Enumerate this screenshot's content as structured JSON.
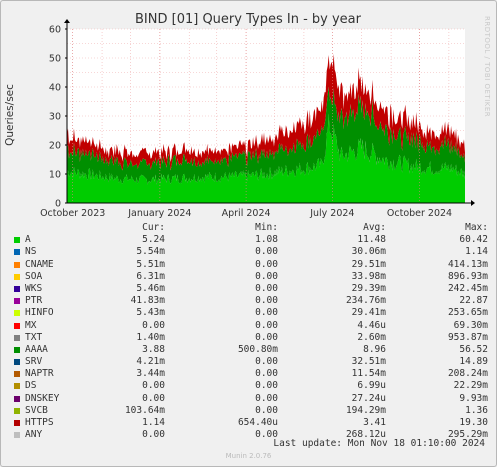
{
  "chart_data": {
    "type": "area",
    "title": "BIND [01] Query Types In - by year",
    "ylabel": "Queries/sec",
    "side_label": "RRDTOOL / TOBI OETIKER",
    "ylim": [
      0,
      60
    ],
    "yticks": [
      0,
      10,
      20,
      30,
      40,
      50,
      60
    ],
    "xlim": [
      "2023-09-25",
      "2024-11-18"
    ],
    "xticks": [
      {
        "date": "2023-10-01",
        "label": "October 2023"
      },
      {
        "date": "2024-01-01",
        "label": "January 2024"
      },
      {
        "date": "2024-04-01",
        "label": "April 2024"
      },
      {
        "date": "2024-07-01",
        "label": "July 2024"
      },
      {
        "date": "2024-10-01",
        "label": "October 2024"
      }
    ],
    "grid": true,
    "colors": {
      "A": "#00cc00",
      "AAAA": "#008f00",
      "HTTPS": "#c00000",
      "background": "#ffffff"
    },
    "series": [
      {
        "name": "A",
        "x": [
          "2023-09-25",
          "2023-10-15",
          "2023-11-15",
          "2023-12-15",
          "2024-01-15",
          "2024-02-15",
          "2024-03-15",
          "2024-04-10",
          "2024-05-10",
          "2024-06-01",
          "2024-06-20",
          "2024-06-28",
          "2024-07-10",
          "2024-08-01",
          "2024-08-25",
          "2024-09-20",
          "2024-10-15",
          "2024-11-05",
          "2024-11-18"
        ],
        "values": [
          11,
          10,
          8.5,
          8,
          8.5,
          9,
          9,
          9.5,
          11,
          12,
          13,
          27,
          16,
          19,
          15,
          13,
          12,
          12,
          10
        ]
      },
      {
        "name": "AAAA",
        "x": [
          "2023-09-25",
          "2023-10-15",
          "2023-11-15",
          "2023-12-15",
          "2024-01-15",
          "2024-02-15",
          "2024-03-15",
          "2024-04-10",
          "2024-05-10",
          "2024-06-01",
          "2024-06-20",
          "2024-06-28",
          "2024-07-10",
          "2024-08-01",
          "2024-08-25",
          "2024-09-20",
          "2024-10-15",
          "2024-11-05",
          "2024-11-18"
        ],
        "values": [
          8,
          7,
          6,
          5.5,
          6,
          6,
          6,
          6.5,
          8,
          9,
          10,
          12,
          12,
          14,
          11,
          9,
          8,
          8,
          5
        ]
      },
      {
        "name": "HTTPS",
        "x": [
          "2023-09-25",
          "2023-10-15",
          "2023-11-15",
          "2023-12-15",
          "2024-01-15",
          "2024-02-15",
          "2024-03-15",
          "2024-04-10",
          "2024-05-10",
          "2024-06-01",
          "2024-06-20",
          "2024-06-28",
          "2024-07-10",
          "2024-08-01",
          "2024-08-25",
          "2024-09-20",
          "2024-10-15",
          "2024-11-05",
          "2024-11-18"
        ],
        "values": [
          5,
          4,
          3.5,
          3.5,
          3.5,
          3.5,
          3.5,
          4,
          6,
          7,
          8,
          13,
          8,
          8,
          7,
          6,
          5,
          5,
          4
        ]
      }
    ]
  },
  "legend": {
    "headers": [
      "Cur:",
      "Min:",
      "Avg:",
      "Max:"
    ],
    "rows": [
      {
        "name": "A",
        "color": "#00cc00",
        "cur": "5.24",
        "min": "1.08",
        "avg": "11.48",
        "max": "60.42"
      },
      {
        "name": "NS",
        "color": "#0066b3",
        "cur": "5.54m",
        "min": "0.00",
        "avg": "30.06m",
        "max": "1.14"
      },
      {
        "name": "CNAME",
        "color": "#ff8000",
        "cur": "5.51m",
        "min": "0.00",
        "avg": "29.51m",
        "max": "414.13m"
      },
      {
        "name": "SOA",
        "color": "#ffcc00",
        "cur": "6.31m",
        "min": "0.00",
        "avg": "33.98m",
        "max": "896.93m"
      },
      {
        "name": "WKS",
        "color": "#330099",
        "cur": "5.46m",
        "min": "0.00",
        "avg": "29.39m",
        "max": "242.45m"
      },
      {
        "name": "PTR",
        "color": "#990099",
        "cur": "41.83m",
        "min": "0.00",
        "avg": "234.76m",
        "max": "22.87"
      },
      {
        "name": "HINFO",
        "color": "#ccff00",
        "cur": "5.43m",
        "min": "0.00",
        "avg": "29.41m",
        "max": "253.65m"
      },
      {
        "name": "MX",
        "color": "#ff0000",
        "cur": "0.00",
        "min": "0.00",
        "avg": "4.46u",
        "max": "69.30m"
      },
      {
        "name": "TXT",
        "color": "#808080",
        "cur": "1.40m",
        "min": "0.00",
        "avg": "2.60m",
        "max": "953.87m"
      },
      {
        "name": "AAAA",
        "color": "#008f00",
        "cur": "3.88",
        "min": "500.80m",
        "avg": "8.96",
        "max": "56.52"
      },
      {
        "name": "SRV",
        "color": "#00487d",
        "cur": "4.21m",
        "min": "0.00",
        "avg": "32.51m",
        "max": "14.89"
      },
      {
        "name": "NAPTR",
        "color": "#b35a00",
        "cur": "3.44m",
        "min": "0.00",
        "avg": "11.54m",
        "max": "208.24m"
      },
      {
        "name": "DS",
        "color": "#b38f00",
        "cur": "0.00",
        "min": "0.00",
        "avg": "6.99u",
        "max": "22.29m"
      },
      {
        "name": "DNSKEY",
        "color": "#6b006b",
        "cur": "0.00",
        "min": "0.00",
        "avg": "27.24u",
        "max": "9.93m"
      },
      {
        "name": "SVCB",
        "color": "#8fb300",
        "cur": "103.64m",
        "min": "0.00",
        "avg": "194.29m",
        "max": "1.36"
      },
      {
        "name": "HTTPS",
        "color": "#b30000",
        "cur": "1.14",
        "min": "654.40u",
        "avg": "3.41",
        "max": "19.30"
      },
      {
        "name": "ANY",
        "color": "#bebebe",
        "cur": "0.00",
        "min": "0.00",
        "avg": "268.12u",
        "max": "295.29m"
      }
    ]
  },
  "last_update": "Last update: Mon Nov 18 01:10:00 2024",
  "footer": "Munin 2.0.76"
}
